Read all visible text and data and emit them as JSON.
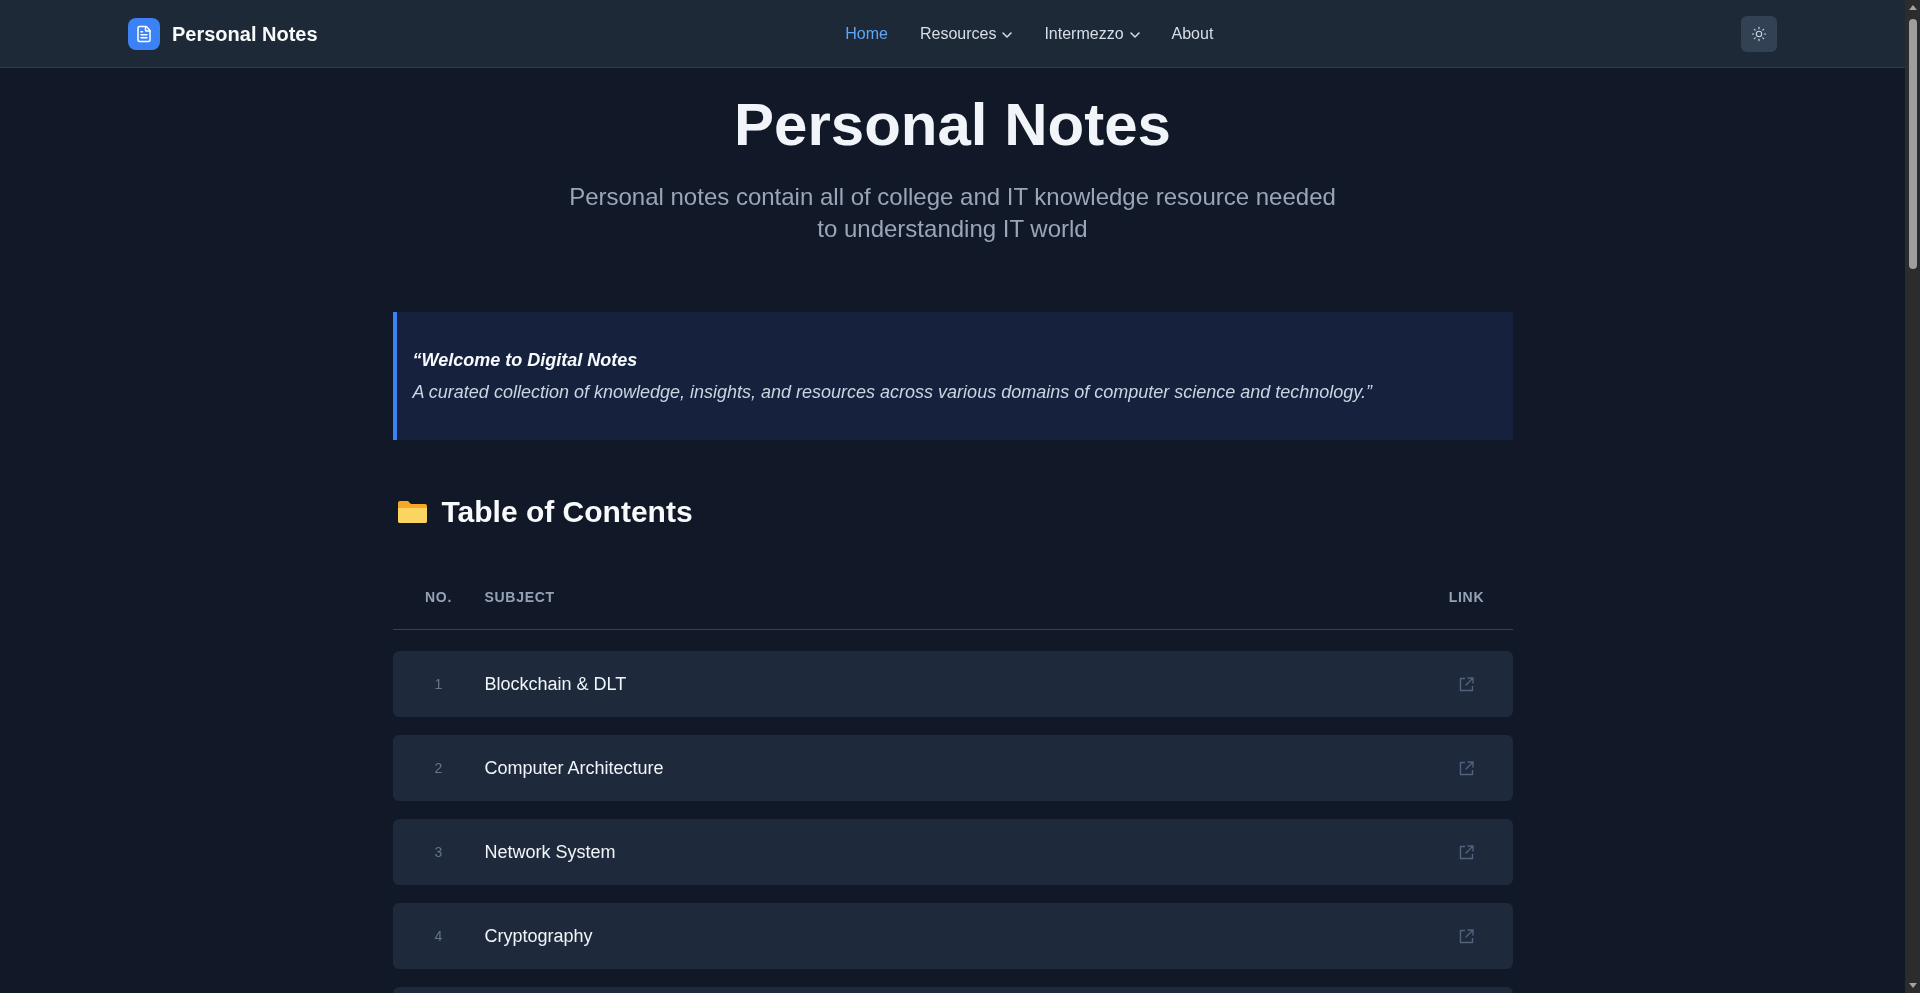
{
  "header": {
    "site_title": "Personal Notes",
    "nav": [
      {
        "label": "Home",
        "kind": "link",
        "selected": true
      },
      {
        "label": "Resources",
        "kind": "dropdown",
        "selected": false
      },
      {
        "label": "Intermezzo",
        "kind": "dropdown",
        "selected": false
      },
      {
        "label": "About",
        "kind": "link",
        "selected": false
      }
    ]
  },
  "hero": {
    "title": "Personal Notes",
    "subtitle": "Personal notes contain all of college and IT knowledge resource needed to understanding IT world"
  },
  "quote": {
    "heading": "“Welcome to Digital Notes",
    "text": "A curated collection of knowledge, insights, and resources across various domains of computer science and technology.”"
  },
  "contents": {
    "heading": "Table of Contents",
    "columns": [
      "NO.",
      "SUBJECT",
      "LINK"
    ],
    "rows": [
      {
        "number": "1",
        "subject": "Blockchain & DLT"
      },
      {
        "number": "2",
        "subject": "Computer Architecture"
      },
      {
        "number": "3",
        "subject": "Network System"
      },
      {
        "number": "4",
        "subject": "Cryptography"
      }
    ]
  }
}
